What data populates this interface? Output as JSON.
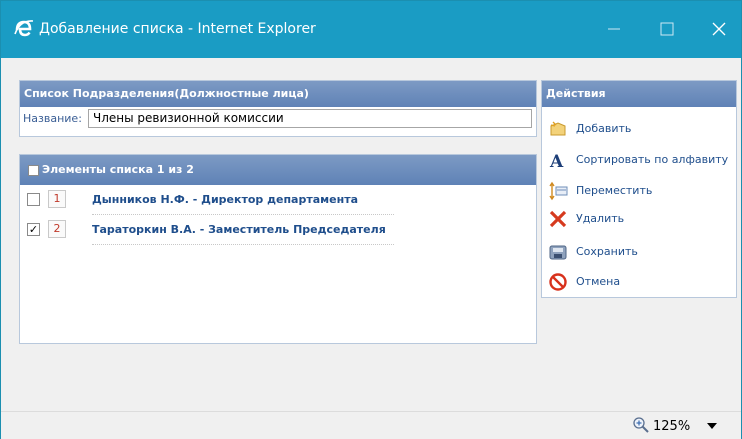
{
  "window": {
    "title": "Добавление списка - Internet Explorer",
    "accent": "#1a9cc4"
  },
  "list_panel": {
    "header": "Список Подразделения(Должностные лица)",
    "name_label": "Название:",
    "name_value": "Члены ревизионной комиссии"
  },
  "items_panel": {
    "header": "Элементы списка 1 из 2",
    "rows": [
      {
        "number": "1",
        "text": "Дынников Н.Ф. - Директор департамента",
        "checked": false,
        "check_glyph": ""
      },
      {
        "number": "2",
        "text": "Тараторкин В.А. - Заместитель Председателя",
        "checked": true,
        "check_glyph": "✓"
      }
    ]
  },
  "actions_panel": {
    "header": "Действия",
    "items": [
      {
        "label": "Добавить",
        "icon": "add-icon"
      },
      {
        "label": "Сортировать по алфавиту",
        "icon": "sort-alpha-icon"
      },
      {
        "label": "Переместить",
        "icon": "move-icon"
      },
      {
        "label": "Удалить",
        "icon": "delete-icon"
      },
      {
        "label": "Сохранить",
        "icon": "save-icon"
      },
      {
        "label": "Отмена",
        "icon": "cancel-icon"
      }
    ]
  },
  "statusbar": {
    "zoom": "125%"
  }
}
